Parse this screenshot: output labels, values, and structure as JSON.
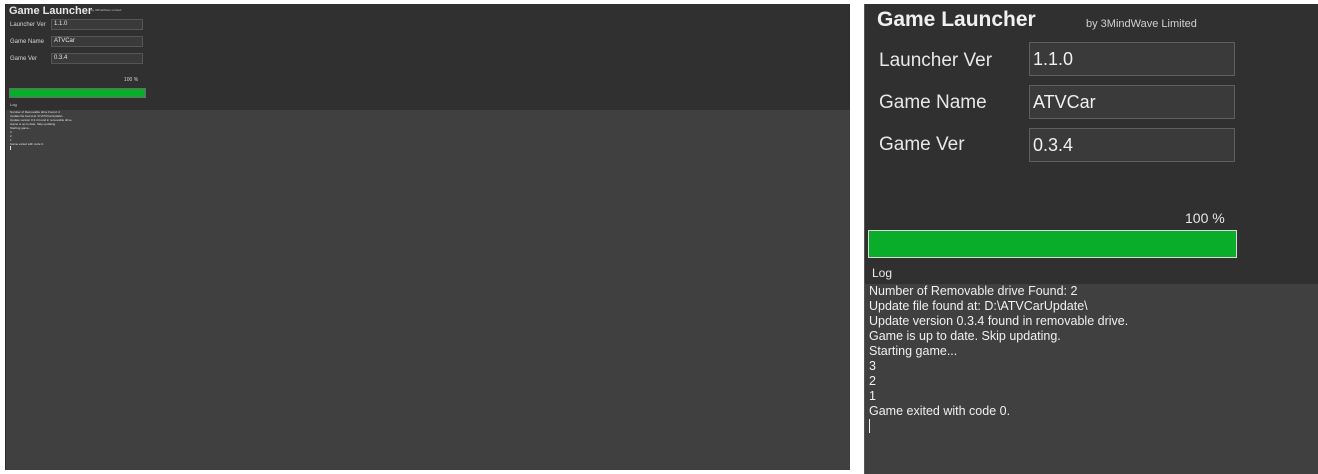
{
  "app": {
    "title": "Game Launcher",
    "byline": "by 3MindWave Limited"
  },
  "fields": [
    {
      "label": "Launcher Ver",
      "value": "1.1.0"
    },
    {
      "label": "Game Name",
      "value": "ATVCar"
    },
    {
      "label": "Game Ver",
      "value": "0.3.4"
    }
  ],
  "progress": {
    "label": "100 %",
    "fraction": 1.0,
    "color": "#09ad29"
  },
  "log": {
    "label": "Log",
    "lines": [
      "Number of Removable drive Found: 2",
      "Update file found at: D:\\ATVCarUpdate\\",
      "Update version 0.3.4 found in removable drive.",
      "Game is up to date. Skip updating.",
      "Starting game...",
      "3",
      "2",
      "1",
      "Game exited with code 0."
    ]
  },
  "colors": {
    "background": "#404040",
    "header_background": "#303030",
    "text": "#f0f0f0",
    "progress_fill": "#09ad29"
  }
}
